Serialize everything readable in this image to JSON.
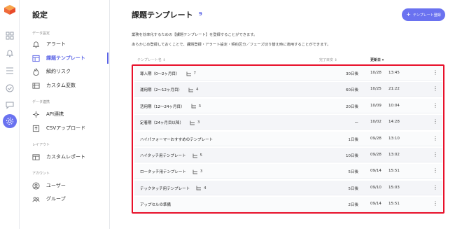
{
  "sidebar": {
    "title": "設定",
    "sections": [
      {
        "label": "データ設定",
        "items": [
          {
            "label": "アラート",
            "icon": "bell-icon"
          },
          {
            "label": "課題テンプレート",
            "icon": "template-icon",
            "active": true
          },
          {
            "label": "解約リスク",
            "icon": "flame-icon"
          },
          {
            "label": "カスタム変数",
            "icon": "table-icon"
          }
        ]
      },
      {
        "label": "データ連携",
        "items": [
          {
            "label": "API連携",
            "icon": "link-icon"
          },
          {
            "label": "CSVアップロード",
            "icon": "upload-icon"
          }
        ]
      },
      {
        "label": "レイアウト",
        "items": [
          {
            "label": "カスタムレポート",
            "icon": "report-icon"
          }
        ]
      },
      {
        "label": "アカウント",
        "items": [
          {
            "label": "ユーザー",
            "icon": "user-icon"
          },
          {
            "label": "グループ",
            "icon": "group-icon"
          }
        ]
      }
    ]
  },
  "header": {
    "title": "課題テンプレート",
    "count": "9",
    "add_button": "テンプレート登録"
  },
  "description": [
    "業務を効率化するための【課題テンプレート】を登録することができます。",
    "あらかじめ登録しておくことで、課題登録・アラート設定・契約区分／フェーズ切り替え時に適用することができます。"
  ],
  "table": {
    "columns": {
      "name": "テンプレート名 ⇕",
      "days": "完了目安 ⇕",
      "updated": "更新日 ▾"
    },
    "rows": [
      {
        "name": "導入期（0〜2ヶ月目）",
        "branches": "7",
        "days": "30日後",
        "date": "10/28",
        "time": "13:45"
      },
      {
        "name": "運用期（2〜12ヶ月目）",
        "branches": "4",
        "days": "60日後",
        "date": "10/25",
        "time": "21:22"
      },
      {
        "name": "活用期（12〜24ヶ月目）",
        "branches": "3",
        "days": "20日後",
        "date": "10/09",
        "time": "10:04"
      },
      {
        "name": "定着期（24ヶ月目以降）",
        "branches": "3",
        "days": "ー",
        "date": "10/02",
        "time": "14:28"
      },
      {
        "name": "ハイパフォーマーおすすめのテンプレート",
        "branches": "",
        "days": "1日後",
        "date": "09/28",
        "time": "13:10"
      },
      {
        "name": "ハイタッチ用テンプレート",
        "branches": "5",
        "days": "10日後",
        "date": "09/28",
        "time": "13:02"
      },
      {
        "name": "ロータッチ用テンプレート",
        "branches": "3",
        "days": "5日後",
        "date": "09/14",
        "time": "15:51"
      },
      {
        "name": "テックタッチ用テンプレート",
        "branches": "4",
        "days": "5日後",
        "date": "09/10",
        "time": "15:03"
      },
      {
        "name": "アップセルの準備",
        "branches": "",
        "days": "2日後",
        "date": "09/14",
        "time": "15:51"
      }
    ]
  },
  "colors": {
    "accent": "#6a72f0",
    "highlight": "#e8102a"
  }
}
